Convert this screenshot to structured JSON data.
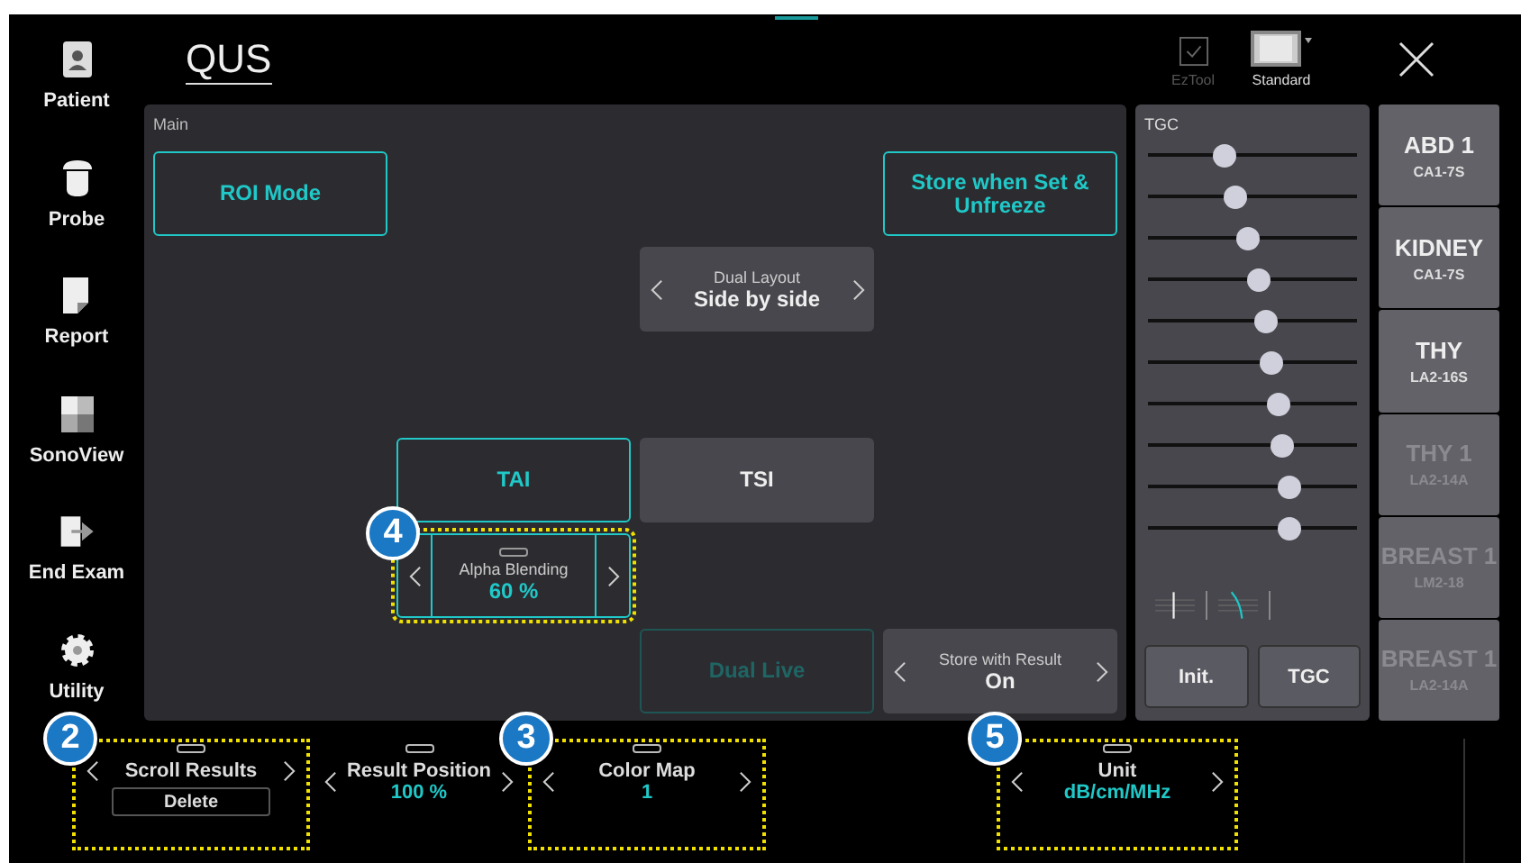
{
  "sidebar": {
    "items": [
      {
        "label": "Patient",
        "kind": "patient"
      },
      {
        "label": "Probe",
        "kind": "probe"
      },
      {
        "label": "Report",
        "kind": "report"
      },
      {
        "label": "SonoView",
        "kind": "sonoview"
      },
      {
        "label": "End Exam",
        "kind": "endexam"
      },
      {
        "label": "Utility",
        "kind": "utility"
      }
    ]
  },
  "header": {
    "title": "QUS",
    "tools": [
      {
        "label": "EzTool",
        "kind": "check",
        "disabled": true
      },
      {
        "label": "Standard",
        "kind": "monitor",
        "disabled": false
      }
    ]
  },
  "main": {
    "label": "Main",
    "rows": [
      [
        {
          "kind": "button",
          "label": "ROI Mode",
          "selected": true,
          "disabled": false
        },
        {
          "kind": "empty"
        },
        {
          "kind": "empty"
        },
        {
          "kind": "button",
          "label": "Store when Set & Unfreeze",
          "selected": true,
          "disabled": false
        }
      ],
      [
        {
          "kind": "empty"
        },
        {
          "kind": "empty"
        },
        {
          "kind": "selector",
          "label": "Dual Layout",
          "value": "Side by side",
          "selected": false,
          "highlighted": false
        },
        {
          "kind": "empty"
        }
      ],
      [
        {
          "kind": "empty"
        },
        {
          "kind": "empty"
        },
        {
          "kind": "empty"
        },
        {
          "kind": "empty"
        }
      ],
      [
        {
          "kind": "empty"
        },
        {
          "kind": "button",
          "label": "TAI",
          "selected": true,
          "disabled": false
        },
        {
          "kind": "button",
          "label": "TSI",
          "selected": false,
          "disabled": false
        },
        {
          "kind": "empty"
        }
      ],
      [
        {
          "kind": "empty"
        },
        {
          "kind": "selector",
          "label": "Alpha Blending",
          "value": "60 %",
          "selected": true,
          "highlighted": true,
          "callout": "4"
        },
        {
          "kind": "empty"
        },
        {
          "kind": "empty"
        }
      ],
      [
        {
          "kind": "empty"
        },
        {
          "kind": "empty"
        },
        {
          "kind": "button",
          "label": "Dual Live",
          "selected": true,
          "disabled": true
        },
        {
          "kind": "selector",
          "label": "Store with Result",
          "value": "On",
          "selected": false,
          "highlighted": false
        }
      ]
    ]
  },
  "tgc": {
    "label": "TGC",
    "sliders": [
      {
        "level": 0.36
      },
      {
        "level": 0.41
      },
      {
        "level": 0.47
      },
      {
        "level": 0.53
      },
      {
        "level": 0.56
      },
      {
        "level": 0.59
      },
      {
        "level": 0.62
      },
      {
        "level": 0.64
      },
      {
        "level": 0.67
      },
      {
        "level": 0.67
      }
    ],
    "buttons": [
      "Init.",
      "TGC"
    ]
  },
  "presets": [
    {
      "name": "ABD 1",
      "probe": "CA1-7S",
      "disabled": false
    },
    {
      "name": "KIDNEY",
      "probe": "CA1-7S",
      "disabled": false
    },
    {
      "name": "THY",
      "probe": "LA2-16S",
      "disabled": false
    },
    {
      "name": "THY 1",
      "probe": "LA2-14A",
      "disabled": true
    },
    {
      "name": "BREAST 1",
      "probe": "LM2-18",
      "disabled": true
    },
    {
      "name": "BREAST 1",
      "probe": "LA2-14A",
      "disabled": true
    }
  ],
  "bottom_bar": {
    "slots": [
      {
        "kind": "selector",
        "label": "Scroll Results",
        "button": "Delete",
        "highlighted": true,
        "callout": "2"
      },
      {
        "kind": "selector",
        "label": "Result Position",
        "value": "100 %",
        "highlighted": false
      },
      {
        "kind": "selector",
        "label": "Color Map",
        "value": "1",
        "highlighted": true,
        "callout": "3"
      },
      {
        "kind": "empty"
      },
      {
        "kind": "selector",
        "label": "Unit",
        "value": "dB/cm/MHz",
        "highlighted": true,
        "callout": "5"
      }
    ]
  }
}
